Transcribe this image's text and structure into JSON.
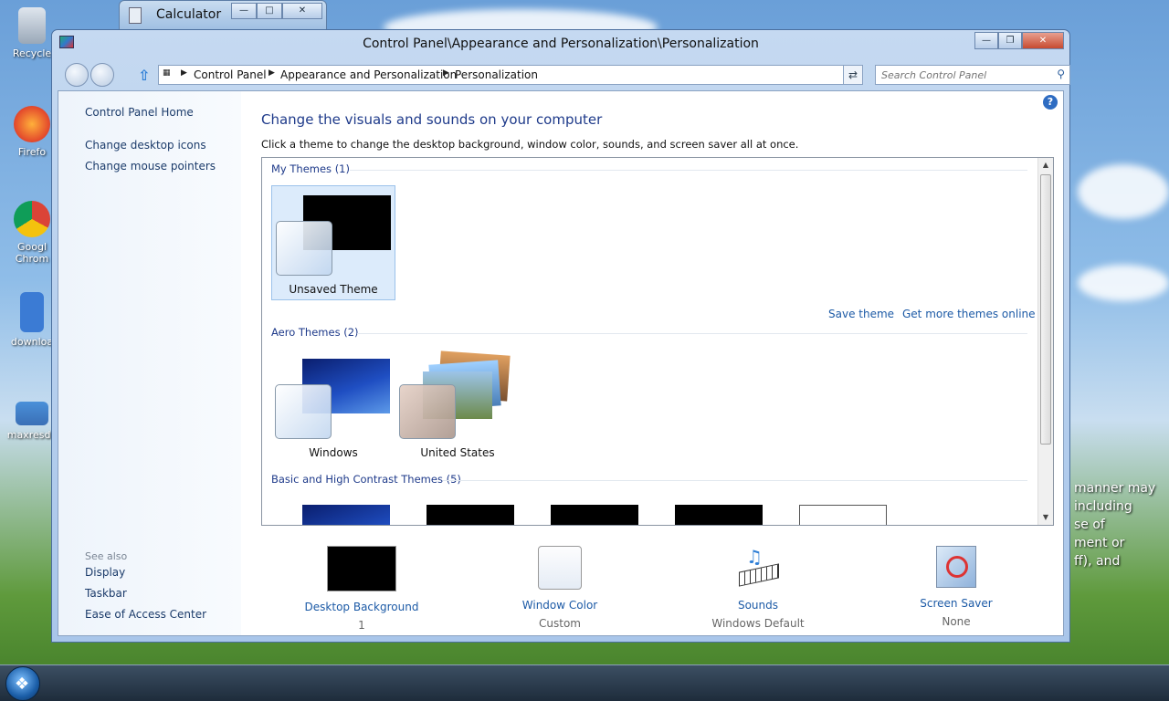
{
  "desktop": {
    "icons": [
      "Recycle",
      "Firefo",
      "Googl Chrom",
      "downloa",
      "maxresde"
    ],
    "watermark_lines": [
      "manner may",
      "including",
      "se of",
      "ment or",
      "ff), and"
    ]
  },
  "calculator": {
    "title": "Calculator"
  },
  "window": {
    "title": "Control Panel\\Appearance and Personalization\\Personalization",
    "address": [
      "Control Panel",
      "Appearance and Personalization",
      "Personalization"
    ],
    "search_placeholder": "Search Control Panel"
  },
  "sidebar": {
    "links": [
      "Control Panel Home",
      "Change desktop icons",
      "Change mouse pointers"
    ],
    "see_also_title": "See also",
    "see_also": [
      "Display",
      "Taskbar",
      "Ease of Access Center"
    ]
  },
  "main": {
    "heading": "Change the visuals and sounds on your computer",
    "description": "Click a theme to change the desktop background, window color, sounds, and screen saver all at once.",
    "groups": {
      "my": {
        "title": "My Themes (1)",
        "themes": [
          "Unsaved Theme"
        ]
      },
      "aero": {
        "title": "Aero Themes (2)",
        "themes": [
          "Windows",
          "United States"
        ]
      },
      "basic": {
        "title": "Basic and High Contrast Themes (5)"
      }
    },
    "save_theme": "Save theme",
    "more_themes": "Get more themes online"
  },
  "bottom": [
    {
      "label": "Desktop Background",
      "value": "1"
    },
    {
      "label": "Window Color",
      "value": "Custom"
    },
    {
      "label": "Sounds",
      "value": "Windows Default"
    },
    {
      "label": "Screen Saver",
      "value": "None"
    }
  ],
  "colors": {
    "link": "#1c5aa6",
    "heading": "#1e3a8a",
    "selection": "#dcebfb"
  }
}
